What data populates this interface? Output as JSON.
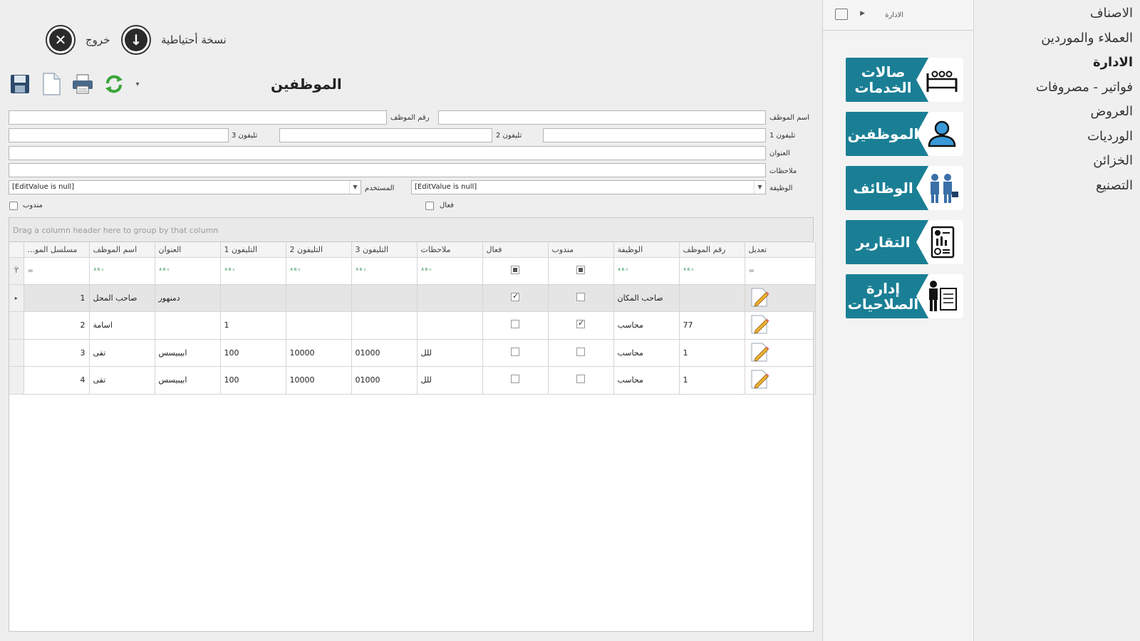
{
  "right_menu": {
    "items": [
      "الاصناف",
      "العملاء والموردين",
      "الادارة",
      "فواتير - مصروفات",
      "العروض",
      "الورديات",
      "الخزائن",
      "التصنيع"
    ],
    "active_index": 2
  },
  "tiles_panel": {
    "breadcrumb": "الادارة",
    "tiles": [
      {
        "label": "صالات الخدمات",
        "icon": "bed-icon"
      },
      {
        "label": "الموظفين",
        "icon": "people-icon"
      },
      {
        "label": "الوظائف",
        "icon": "business-people-icon"
      },
      {
        "label": "التقارير",
        "icon": "report-icon"
      },
      {
        "label": "إدارة الصلاحيات",
        "icon": "admin-board-icon"
      }
    ],
    "accent": "#1a7f95"
  },
  "top_actions": {
    "exit_label": "خروج",
    "backup_label": "نسخة أحتياطية"
  },
  "form": {
    "title": "الموظفين",
    "labels": {
      "emp_name": "اسم الموظف",
      "emp_no": "رقم الموظف",
      "phone1": "تليفون 1",
      "phone2": "تليفون 2",
      "phone3": "تليفون 3",
      "address": "العنوان",
      "notes": "ملاحظات",
      "job": "الوظيفة",
      "user": "المستخدم",
      "active": "فعال",
      "delegate": "مندوب"
    },
    "values": {
      "emp_name": "",
      "emp_no": "",
      "phone1": "",
      "phone2": "",
      "phone3": "",
      "address": "",
      "notes": "",
      "job": "[EditValue is null]",
      "user": "[EditValue is null]",
      "active": false,
      "delegate": false
    }
  },
  "grid": {
    "group_panel_text": "Drag a column header here to group by that column",
    "columns": [
      "مسلسل المو...",
      "اسم الموظف",
      "العنوان",
      "التليفون 1",
      "التليفون 2",
      "التليفون 3",
      "ملاحظات",
      "فعال",
      "مندوب",
      "الوظيفة",
      "رقم الموظف",
      "تعديل"
    ],
    "filter_symbol": "=",
    "filter_icon": "abc-filter-icon",
    "rows": [
      {
        "serial": "1",
        "name": "صاحب المحل",
        "address": "دمنهور",
        "phone1": "",
        "phone2": "",
        "phone3": "",
        "notes": "",
        "active": true,
        "delegate": false,
        "job": "صاحب المكان",
        "emp_no": ""
      },
      {
        "serial": "2",
        "name": "اسامة",
        "address": "",
        "phone1": "1",
        "phone2": "",
        "phone3": "",
        "notes": "",
        "active": false,
        "delegate": true,
        "job": "محاسب",
        "emp_no": "77"
      },
      {
        "serial": "3",
        "name": "تقى",
        "address": "ابيبيسس",
        "phone1": "100",
        "phone2": "10000",
        "phone3": "01000",
        "notes": "للل",
        "active": false,
        "delegate": false,
        "job": "محاسب",
        "emp_no": "1"
      },
      {
        "serial": "4",
        "name": "تقى",
        "address": "ابيبيسس",
        "phone1": "100",
        "phone2": "10000",
        "phone3": "01000",
        "notes": "للل",
        "active": false,
        "delegate": false,
        "job": "محاسب",
        "emp_no": "1"
      }
    ]
  }
}
